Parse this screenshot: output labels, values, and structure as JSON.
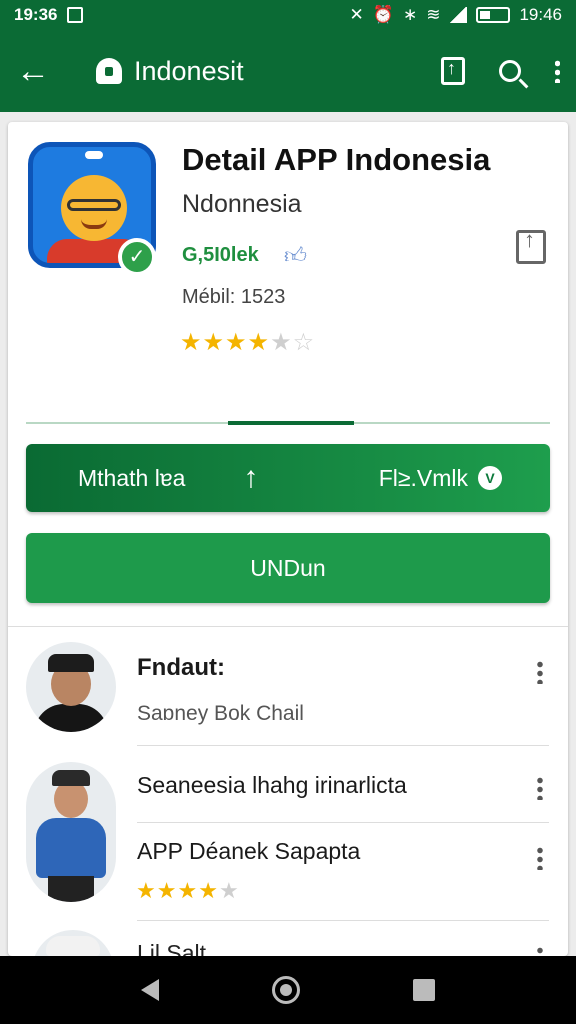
{
  "status_bar": {
    "time": "19:36",
    "clock_right": "19:46",
    "icons": [
      "image-icon",
      "mute-icon",
      "alarm-icon",
      "bluetooth-icon",
      "wifi-icon",
      "signal-icon",
      "battery-icon"
    ]
  },
  "app_bar": {
    "title": "Indonesit",
    "icons": [
      "back-arrow-icon",
      "home-icon",
      "share-icon",
      "search-icon",
      "more-icon"
    ]
  },
  "app": {
    "title": "Detail APP Indonesia",
    "developer": "Ndonnesia",
    "tag": "G,5I0lek",
    "meta": "Mébil: 1523",
    "rating_stars": 4,
    "rating_max": 6
  },
  "actions": {
    "left_label": "Mthath lɐa",
    "up_label": "↑",
    "right_label": "Fl≥.Vmlk",
    "play_glyph": "V",
    "install_label": "UNDun"
  },
  "reviews": [
    {
      "name": "Fndaut:",
      "subtitle": "Saɒney  Bok Chail"
    },
    {
      "line1": "Seaneesia lhahg irinarlicta",
      "line2": "APP Déanek Sapapta",
      "stars": 4,
      "max": 5
    },
    {
      "partial": "Lil Salt..."
    }
  ],
  "colors": {
    "brand": "#0b6b35",
    "install": "#1e9a4b",
    "star": "#f4b400"
  }
}
